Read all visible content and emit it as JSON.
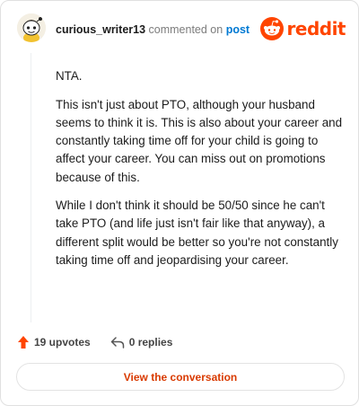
{
  "header": {
    "username": "curious_writer13",
    "commented_on": "commented on",
    "post_link": "post",
    "logo_text": "reddit"
  },
  "comment": {
    "paragraphs": [
      "NTA.",
      "This isn't just about PTO, although your husband seems to think it is. This is also about your career and constantly taking time off for your child is going to affect your career. You can miss out on promotions because of this.",
      "While I don't think it should be 50/50 since he can't take PTO (and life just isn't fair like that anyway), a different split would be better so you're not constantly taking time off and jeopardising your career."
    ]
  },
  "actions": {
    "upvotes": "19 upvotes",
    "replies": "0 replies"
  },
  "view_button": "View the conversation",
  "colors": {
    "brand": "#ff4500",
    "link": "#0079d3",
    "upvote": "#ff4500",
    "button_text": "#d93a00"
  },
  "icons": {
    "avatar": "snoo-avatar",
    "logo": "reddit-logo-icon",
    "upvote": "upvote-arrow-icon",
    "reply": "reply-arrow-icon"
  }
}
